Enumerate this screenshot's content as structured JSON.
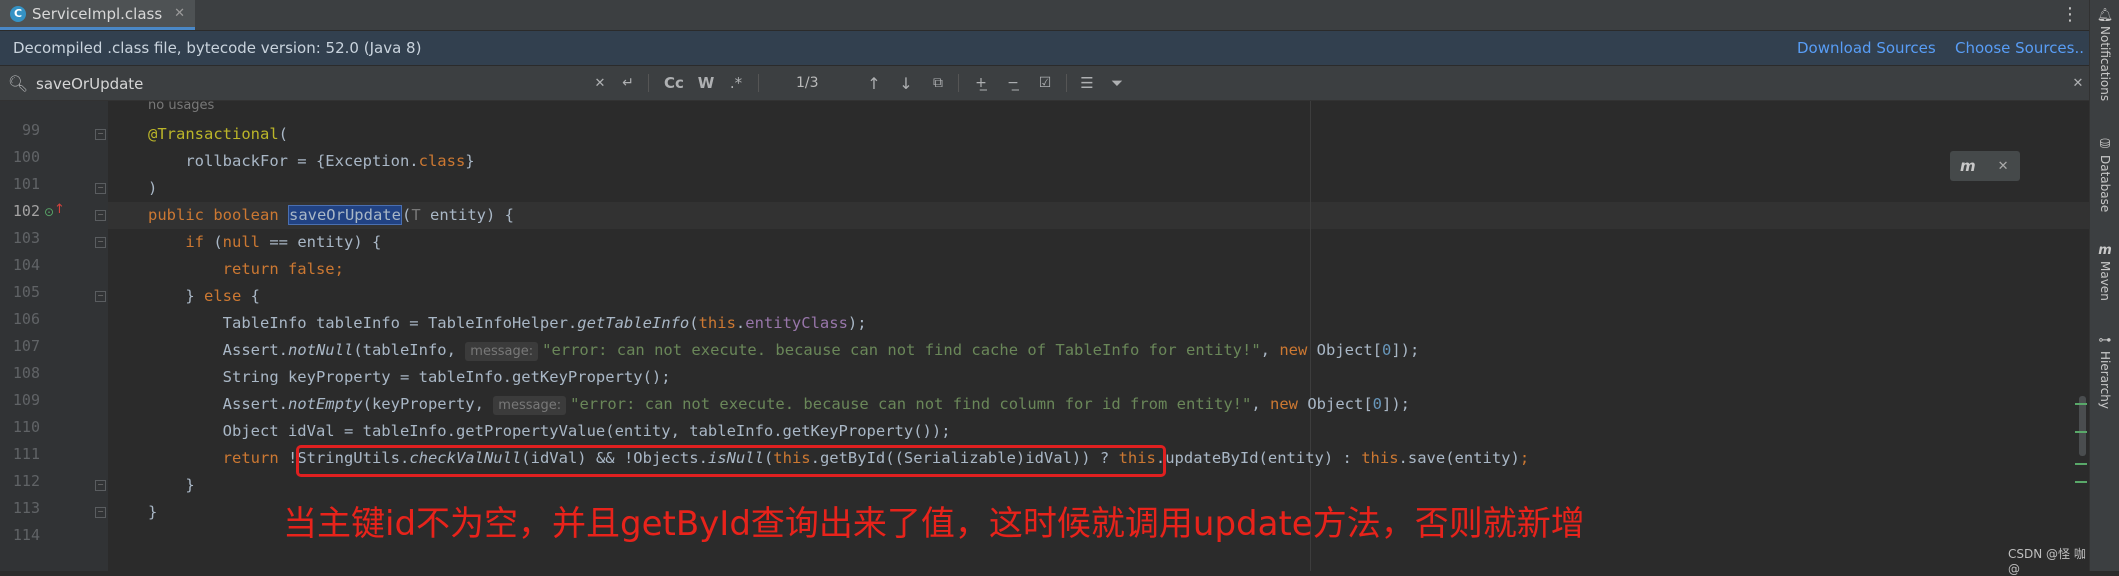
{
  "tab": {
    "icon_letter": "C",
    "label": "ServiceImpl.class"
  },
  "banner": {
    "text": "Decompiled .class file, bytecode version: 52.0 (Java 8)",
    "download_sources": "Download Sources",
    "choose_sources": "Choose Sources.."
  },
  "find": {
    "query": "saveOrUpdate",
    "match_count": "1/3",
    "case_label": "Cc",
    "word_label": "W",
    "regex_label": ".*"
  },
  "editor": {
    "usages": "no usages",
    "line_numbers": [
      "99",
      "100",
      "101",
      "102",
      "103",
      "104",
      "105",
      "106",
      "107",
      "108",
      "109",
      "110",
      "111",
      "112",
      "113",
      "114"
    ],
    "hint_message": "message:",
    "annotation_note": "当主键id不为空，并且getById查询出来了值，这时候就调用update方法，否则就新增"
  },
  "popup": {
    "icon": "m"
  },
  "right_strip": {
    "notifications": "Notifications",
    "database": "Database",
    "maven": "Maven",
    "hierarchy": "Hierarchy"
  },
  "watermark": "CSDN @怪 咖@",
  "colors": {
    "keyword": "#cc7832",
    "annotation": "#bbb529",
    "string": "#6a8759",
    "number": "#6897bb",
    "field": "#9876aa",
    "red_note": "#e8231b"
  }
}
